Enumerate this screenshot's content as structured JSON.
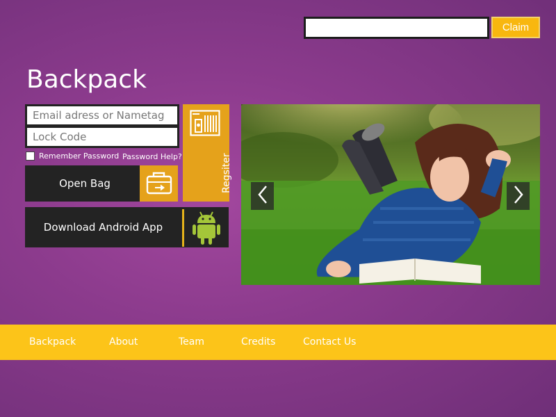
{
  "claim": {
    "input_value": "",
    "button_label": "Claim"
  },
  "brand": {
    "title": "Backpack"
  },
  "login": {
    "email_placeholder": "Email adress or Nametag",
    "lock_placeholder": "Lock Code",
    "remember_label": "Remember Password",
    "remember_checked": false,
    "help_label": "Password Help?",
    "register_label": "Regsiter",
    "open_bag_label": "Open Bag",
    "android_label": "Download Android App"
  },
  "carousel": {
    "image_icon": "photo-girl-reading-on-grass",
    "prev_icon": "chevron-left-icon",
    "next_icon": "chevron-right-icon"
  },
  "footer": {
    "links": [
      "Backpack",
      "About",
      "Team",
      "Credits",
      "Contact Us"
    ]
  },
  "colors": {
    "background": "#8c3b8d",
    "accent": "#e5a21b",
    "footer": "#fcc419",
    "dark": "#232323"
  }
}
